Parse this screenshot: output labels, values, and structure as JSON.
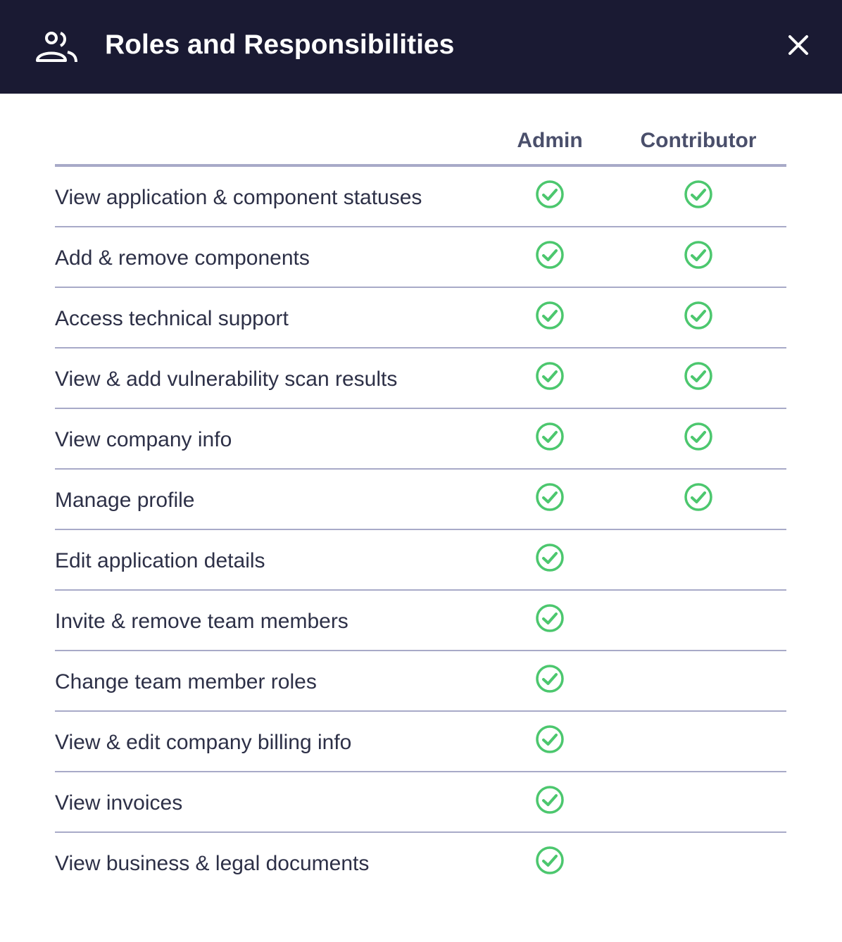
{
  "header": {
    "icon": "people-icon",
    "title": "Roles and Responsibilities",
    "close_icon": "close-icon",
    "background": "#1a1a33"
  },
  "table": {
    "columns": [
      "Admin",
      "Contributor"
    ],
    "check_color": "#4cc76e",
    "rows": [
      {
        "label": "View application & component statuses",
        "admin": true,
        "contributor": true
      },
      {
        "label": "Add & remove components",
        "admin": true,
        "contributor": true
      },
      {
        "label": "Access technical support",
        "admin": true,
        "contributor": true
      },
      {
        "label": "View & add vulnerability scan results",
        "admin": true,
        "contributor": true
      },
      {
        "label": "View company info",
        "admin": true,
        "contributor": true
      },
      {
        "label": "Manage profile",
        "admin": true,
        "contributor": true
      },
      {
        "label": "Edit application details",
        "admin": true,
        "contributor": false
      },
      {
        "label": "Invite & remove team members",
        "admin": true,
        "contributor": false
      },
      {
        "label": "Change team member roles",
        "admin": true,
        "contributor": false
      },
      {
        "label": "View & edit company billing info",
        "admin": true,
        "contributor": false
      },
      {
        "label": "View invoices",
        "admin": true,
        "contributor": false
      },
      {
        "label": "View business & legal documents",
        "admin": true,
        "contributor": false
      }
    ]
  }
}
